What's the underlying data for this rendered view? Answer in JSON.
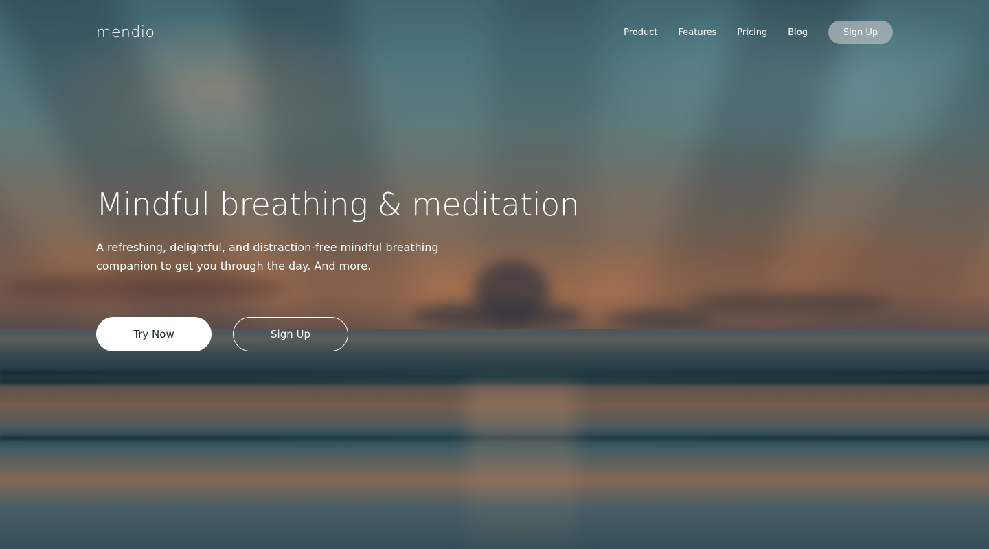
{
  "brand": {
    "logo_text": "mendio"
  },
  "nav": {
    "links": [
      {
        "label": "Product"
      },
      {
        "label": "Features"
      },
      {
        "label": "Pricing"
      },
      {
        "label": "Blog"
      }
    ],
    "signup_label": "Sign Up"
  },
  "hero": {
    "headline": "Mindful breathing & meditation",
    "subtext": "A refreshing, delightful, and distraction-free mindful breathing companion to get you through the day. And more.",
    "primary_cta": "Try Now",
    "secondary_cta": "Sign Up"
  },
  "colors": {
    "primary_button_bg": "#ffffff",
    "primary_button_text": "#1d2a30",
    "nav_signup_bg": "#afb9bc"
  }
}
